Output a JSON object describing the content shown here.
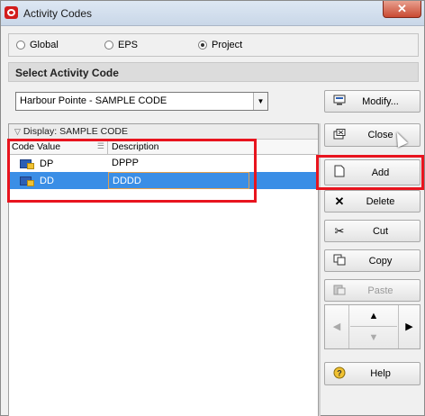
{
  "window": {
    "title": "Activity Codes",
    "close_glyph": "✕"
  },
  "scope": {
    "options": [
      {
        "label": "Global",
        "selected": false
      },
      {
        "label": "EPS",
        "selected": false
      },
      {
        "label": "Project",
        "selected": true
      }
    ]
  },
  "section": {
    "title": "Select Activity Code"
  },
  "code_select": {
    "value": "Harbour Pointe - SAMPLE CODE"
  },
  "list": {
    "display_label": "Display: SAMPLE CODE",
    "columns": [
      "Code Value",
      "Description"
    ],
    "rows": [
      {
        "code": "DP",
        "description": "DPPP",
        "selected": false
      },
      {
        "code": "DD",
        "description": "DDDD",
        "selected": true
      }
    ]
  },
  "buttons": {
    "modify": {
      "label": "Modify...",
      "icon": "modify-icon"
    },
    "close": {
      "label": "Close",
      "icon": "close-icon"
    },
    "add": {
      "label": "Add",
      "icon": "new-document-icon"
    },
    "delete": {
      "label": "Delete",
      "icon": "delete-x-icon"
    },
    "cut": {
      "label": "Cut",
      "icon": "scissors-icon"
    },
    "copy": {
      "label": "Copy",
      "icon": "copy-icon"
    },
    "paste": {
      "label": "Paste",
      "icon": "paste-icon",
      "enabled": false
    },
    "help": {
      "label": "Help",
      "icon": "help-icon"
    }
  },
  "colors": {
    "highlight": "#e8141e",
    "selection": "#3a8ee6"
  }
}
